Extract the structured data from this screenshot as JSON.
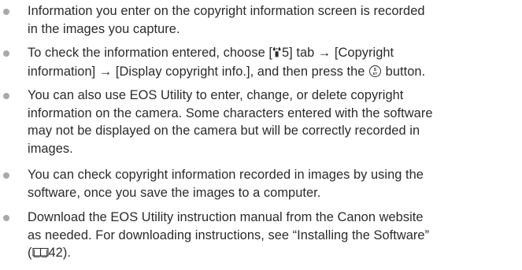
{
  "notes": [
    {
      "line1": "Information you enter on the copyright information screen is recorded",
      "line2": "in the images you capture."
    },
    {
      "line1_a": "To check the information entered, choose [",
      "tab_glyph": "♠",
      "tab_number": "5",
      "line1_b": "] tab → [Copyright",
      "line2_a": "information] → [Display copyright info.], and then press the ",
      "button_label": "SET",
      "line2_b": " button."
    },
    {
      "line1": "You can also use EOS Utility to enter, change, or delete copyright",
      "line2": "information on the camera. Some characters entered with the software",
      "line3": "may not be displayed on the camera but will be correctly recorded in",
      "line4": "images."
    },
    {
      "line1": "You can check copyright information recorded in images by using the",
      "line2": "software, once you save the images to a computer."
    },
    {
      "line1": "Download the EOS Utility instruction manual from the Canon website",
      "line2": "as needed. For downloading instructions, see “Installing the Software”",
      "line3_a": "(",
      "page_ref": "42",
      "line3_b": ")."
    }
  ],
  "icons": {
    "bullet": "bullet-dot",
    "tab": "wrench-icon",
    "button": "set-button-icon",
    "page_ref": "book-icon"
  },
  "colors": {
    "text": "#2b2b2b",
    "bullet": "#a9a9a9"
  }
}
